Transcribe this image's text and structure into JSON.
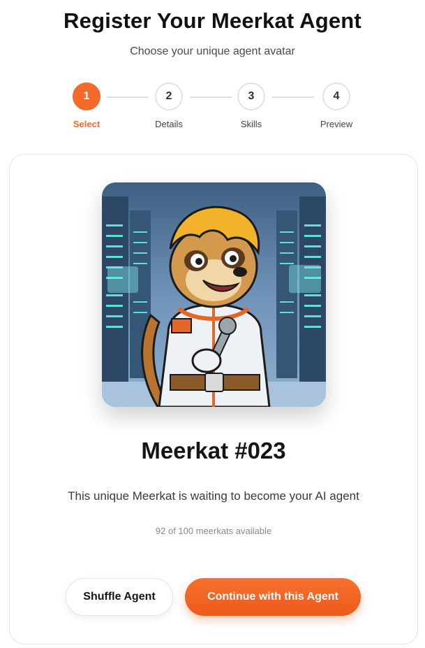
{
  "header": {
    "title": "Register Your Meerkat Agent",
    "subtitle": "Choose your unique agent avatar"
  },
  "stepper": {
    "current_step": 1,
    "steps": [
      {
        "number": "1",
        "label": "Select"
      },
      {
        "number": "2",
        "label": "Details"
      },
      {
        "number": "3",
        "label": "Skills"
      },
      {
        "number": "4",
        "label": "Preview"
      }
    ]
  },
  "agent": {
    "name": "Meerkat #023",
    "description": "This unique Meerkat is waiting to become your AI agent",
    "availability": "92 of 100 meerkats available"
  },
  "actions": {
    "shuffle_label": "Shuffle Agent",
    "continue_label": "Continue with this Agent"
  },
  "colors": {
    "accent": "#f26b2a",
    "step_inactive_border": "#e2e2e2"
  }
}
